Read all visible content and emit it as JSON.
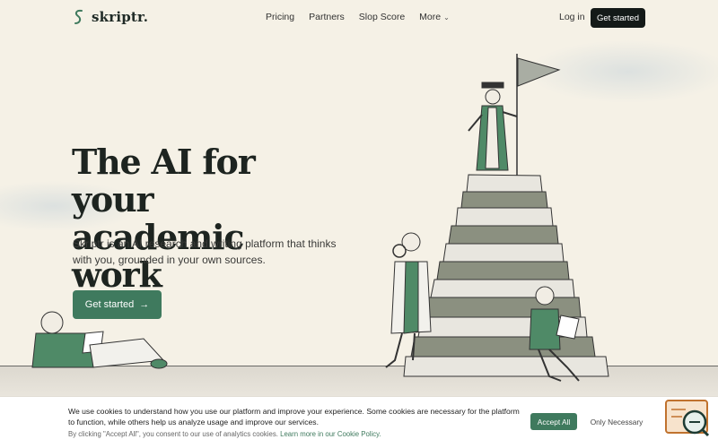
{
  "nav": {
    "logo_text": "skriptr.",
    "links": [
      "Pricing",
      "Partners",
      "Slop Score",
      "More"
    ],
    "login": "Log in",
    "cta": "Get started"
  },
  "hero": {
    "headline_line1": "The AI for your",
    "headline_line2": "academic work",
    "subtitle": "Skriptr is an AI research and writing platform that thinks with you, grounded in your own sources.",
    "cta": "Get started"
  },
  "cookie": {
    "text": "We use cookies to understand how you use our platform and improve your experience. Some cookies are necessary for the platform to function, while others help us analyze usage and improve our services.",
    "note_prefix": "By clicking \"Accept All\", you consent to our use of analytics cookies.",
    "note_link": "Learn more in our Cookie Policy.",
    "accept": "Accept All",
    "only_necessary": "Only Necessary"
  },
  "icons": {
    "logo": "skriptr-logo-icon",
    "more_chevron": "chevron-down-icon",
    "cta_arrow": "arrow-right-icon",
    "chat": "chat-support-icon"
  },
  "colors": {
    "brand_green": "#3f7a5e",
    "dark_button": "#141a18",
    "background": "#f5f1e6"
  }
}
